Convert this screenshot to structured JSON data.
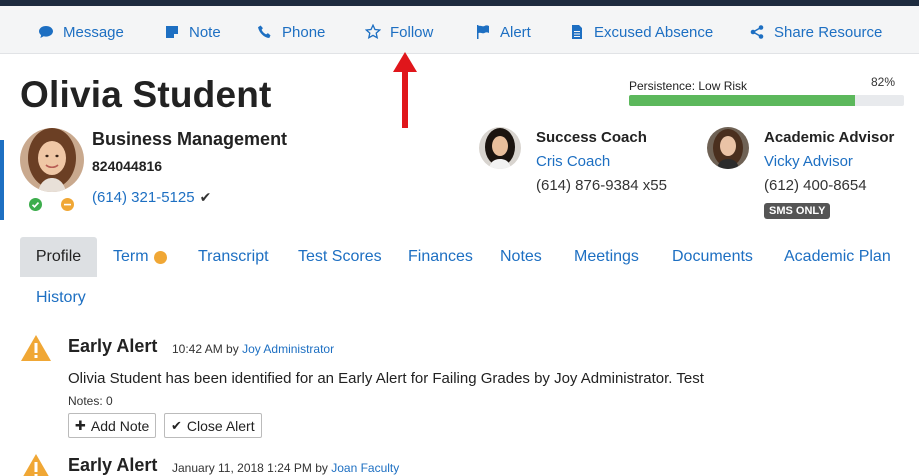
{
  "actions": [
    {
      "label": "Message",
      "icon": "comment-icon"
    },
    {
      "label": "Note",
      "icon": "note-icon"
    },
    {
      "label": "Phone",
      "icon": "phone-icon"
    },
    {
      "label": "Follow",
      "icon": "star-icon"
    },
    {
      "label": "Alert",
      "icon": "flag-icon"
    },
    {
      "label": "Excused Absence",
      "icon": "file-icon"
    },
    {
      "label": "Share Resource",
      "icon": "share-icon"
    }
  ],
  "student": {
    "name": "Olivia Student",
    "major": "Business Management",
    "id": "824044816",
    "phone": "(614) 321-5125",
    "phone_verified_icon": "check-icon"
  },
  "persistence": {
    "label": "Persistence: Low Risk",
    "percent_text": "82%",
    "value": 82
  },
  "contacts": [
    {
      "role": "Success Coach",
      "name": "Cris Coach",
      "phone": "(614) 876-9384 x55"
    },
    {
      "role": "Academic Advisor",
      "name": "Vicky Advisor",
      "phone": "(612) 400-8654",
      "badge": "SMS ONLY"
    }
  ],
  "tabs": [
    "Profile",
    "Term",
    "Transcript",
    "Test Scores",
    "Finances",
    "Notes",
    "Meetings",
    "Documents",
    "Academic Plan",
    "History"
  ],
  "alerts": [
    {
      "title": "Early Alert",
      "time": "10:42 AM by",
      "author": "Joy Administrator",
      "body": "Olivia Student has been identified for an Early Alert for Failing Grades by Joy Administrator. Test",
      "notes": "Notes: 0",
      "add_note": "Add Note",
      "close_alert": "Close Alert"
    },
    {
      "title": "Early Alert",
      "time": "January 11, 2018 1:24 PM by",
      "author": "Joan Faculty"
    }
  ],
  "colors": {
    "link": "#1d6fc2",
    "progress": "#5cb85c",
    "status_green": "#3cad4c",
    "status_orange": "#f0a735",
    "alert_triangle": "#f0a735",
    "annotation_arrow": "#e0161b"
  }
}
